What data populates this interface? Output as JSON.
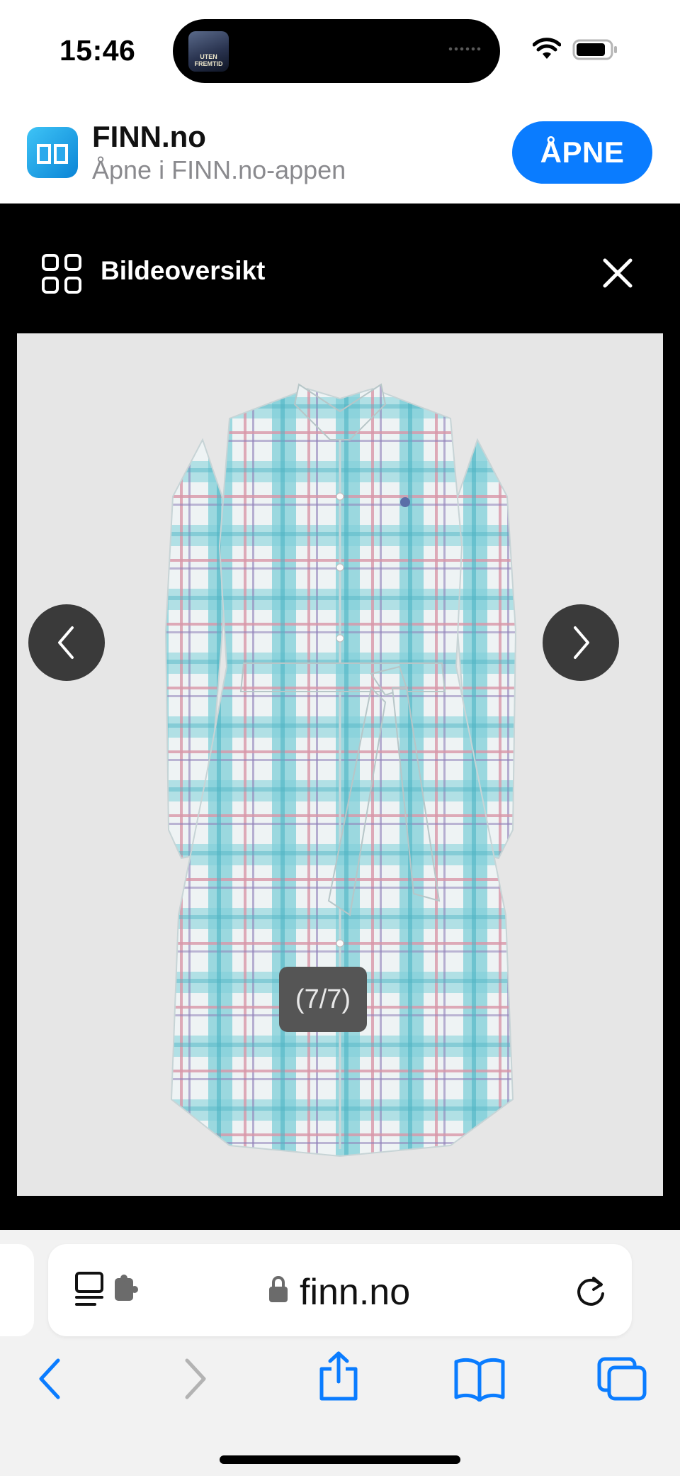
{
  "status_bar": {
    "time": "15:46",
    "now_playing_art_text": "UTEN FREMTID",
    "icons": [
      "wifi-icon",
      "battery-icon"
    ]
  },
  "app_banner": {
    "app_name": "FINN.no",
    "subtitle": "Åpne i FINN.no-appen",
    "open_label": "ÅPNE",
    "icon": "finn-app-icon",
    "accent_color": "#0a7cff"
  },
  "gallery": {
    "title": "Bildeoversikt",
    "grid_icon": "grid-icon",
    "close_icon": "close-icon",
    "counter": "(7/7)",
    "prev_icon": "chevron-left-icon",
    "next_icon": "chevron-right-icon",
    "image_subject": "plaid-shirt-dress"
  },
  "safari": {
    "domain": "finn.no",
    "icons": [
      "reader-icon",
      "extension-icon",
      "lock-icon",
      "reload-icon",
      "back-icon",
      "forward-icon",
      "share-icon",
      "bookmarks-icon",
      "tabs-icon"
    ],
    "tint_color": "#0a7cff"
  }
}
